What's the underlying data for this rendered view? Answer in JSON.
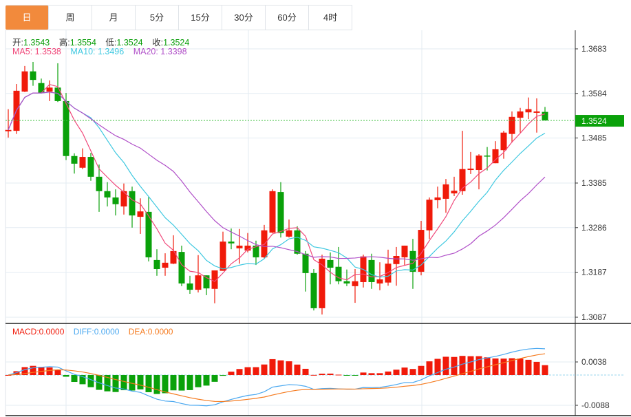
{
  "tabs": [
    "日",
    "周",
    "月",
    "5分",
    "15分",
    "30分",
    "60分",
    "4时"
  ],
  "active_tab": 0,
  "ohlc": {
    "open_label": "开:",
    "open": "1.3543",
    "high_label": "高:",
    "high": "1.3554",
    "low_label": "低:",
    "low": "1.3524",
    "close_label": "收:",
    "close": "1.3524"
  },
  "ma": {
    "ma5": "MA5: 1.3538",
    "ma10": "MA10: 1.3496",
    "ma20": "MA20: 1.3398"
  },
  "macd_legend": {
    "macd": "MACD:0.0000",
    "diff": "DIFF:0.0000",
    "dea": "DEA:0.0000"
  },
  "colors": {
    "up": "#f01a0a",
    "down": "#0aa10a",
    "ma5": "#f0487a",
    "ma10": "#3ec8e0",
    "ma20": "#b04fc8",
    "tab_active": "#f28a3c",
    "diff": "#4aa8f0",
    "dea": "#f57a1e"
  },
  "chart_data": {
    "type": "candlestick",
    "price_axis": {
      "ticks": [
        "1.3683",
        "1.3584",
        "1.3485",
        "1.3385",
        "1.3286",
        "1.3187",
        "1.3087"
      ],
      "range": [
        1.3087,
        1.3683
      ]
    },
    "last_price": "1.3524",
    "macd_axis": {
      "ticks": [
        "0.0038",
        "-0.0088"
      ]
    },
    "candles": [
      [
        1.35,
        1.3549,
        1.3486,
        1.3503
      ],
      [
        1.3501,
        1.3605,
        1.3494,
        1.359
      ],
      [
        1.3588,
        1.3645,
        1.3587,
        1.3633
      ],
      [
        1.3633,
        1.3654,
        1.3601,
        1.3614
      ],
      [
        1.3607,
        1.3617,
        1.3584,
        1.3585
      ],
      [
        1.3588,
        1.3613,
        1.3567,
        1.3597
      ],
      [
        1.3597,
        1.3651,
        1.3565,
        1.3567
      ],
      [
        1.3567,
        1.3585,
        1.3436,
        1.3445
      ],
      [
        1.3445,
        1.3451,
        1.3406,
        1.3428
      ],
      [
        1.3419,
        1.3462,
        1.3416,
        1.3443
      ],
      [
        1.3443,
        1.3452,
        1.339,
        1.3399
      ],
      [
        1.3399,
        1.3426,
        1.3321,
        1.3367
      ],
      [
        1.3367,
        1.3387,
        1.3333,
        1.3353
      ],
      [
        1.3353,
        1.3371,
        1.3313,
        1.3338
      ],
      [
        1.3333,
        1.3384,
        1.3315,
        1.3367
      ],
      [
        1.3367,
        1.3377,
        1.3286,
        1.3313
      ],
      [
        1.331,
        1.3351,
        1.3272,
        1.3322
      ],
      [
        1.3321,
        1.3354,
        1.3211,
        1.322
      ],
      [
        1.3214,
        1.3238,
        1.3179,
        1.3194
      ],
      [
        1.3197,
        1.3229,
        1.3179,
        1.3208
      ],
      [
        1.3206,
        1.3269,
        1.3205,
        1.3234
      ],
      [
        1.3232,
        1.3246,
        1.3156,
        1.3162
      ],
      [
        1.3162,
        1.3179,
        1.3139,
        1.3148
      ],
      [
        1.3148,
        1.3225,
        1.3142,
        1.318
      ],
      [
        1.318,
        1.318,
        1.3136,
        1.3151
      ],
      [
        1.315,
        1.3191,
        1.3118,
        1.3191
      ],
      [
        1.319,
        1.3277,
        1.319,
        1.3255
      ],
      [
        1.3255,
        1.3284,
        1.3238,
        1.3251
      ],
      [
        1.324,
        1.3283,
        1.3206,
        1.3246
      ],
      [
        1.3235,
        1.3274,
        1.3231,
        1.3246
      ],
      [
        1.3246,
        1.3257,
        1.3203,
        1.322
      ],
      [
        1.322,
        1.3292,
        1.3217,
        1.328
      ],
      [
        1.3275,
        1.3371,
        1.3274,
        1.3367
      ],
      [
        1.3365,
        1.3387,
        1.3264,
        1.3274
      ],
      [
        1.3266,
        1.3304,
        1.3264,
        1.328
      ],
      [
        1.328,
        1.3289,
        1.3226,
        1.3228
      ],
      [
        1.3228,
        1.3234,
        1.3144,
        1.3185
      ],
      [
        1.3185,
        1.3194,
        1.3102,
        1.3107
      ],
      [
        1.3107,
        1.3226,
        1.3093,
        1.3217
      ],
      [
        1.3214,
        1.3231,
        1.316,
        1.3197
      ],
      [
        1.3199,
        1.3243,
        1.316,
        1.3167
      ],
      [
        1.3167,
        1.3193,
        1.3156,
        1.3162
      ],
      [
        1.3156,
        1.3194,
        1.3119,
        1.3167
      ],
      [
        1.3165,
        1.3226,
        1.3153,
        1.3222
      ],
      [
        1.3214,
        1.3228,
        1.315,
        1.3165
      ],
      [
        1.3162,
        1.3209,
        1.3147,
        1.3171
      ],
      [
        1.3164,
        1.3237,
        1.3157,
        1.3206
      ],
      [
        1.3205,
        1.3243,
        1.3157,
        1.3223
      ],
      [
        1.322,
        1.3246,
        1.3203,
        1.3246
      ],
      [
        1.3234,
        1.3261,
        1.315,
        1.3188
      ],
      [
        1.3188,
        1.3301,
        1.318,
        1.3281
      ],
      [
        1.328,
        1.3353,
        1.3261,
        1.3348
      ],
      [
        1.3347,
        1.3377,
        1.3329,
        1.3353
      ],
      [
        1.335,
        1.3394,
        1.3319,
        1.3382
      ],
      [
        1.3362,
        1.3399,
        1.3356,
        1.3368
      ],
      [
        1.3367,
        1.3501,
        1.3359,
        1.3416
      ],
      [
        1.3414,
        1.3454,
        1.3405,
        1.3417
      ],
      [
        1.3414,
        1.3449,
        1.3371,
        1.3446
      ],
      [
        1.3446,
        1.3465,
        1.3413,
        1.3445
      ],
      [
        1.3429,
        1.3478,
        1.3429,
        1.346
      ],
      [
        1.3458,
        1.3501,
        1.3439,
        1.3497
      ],
      [
        1.3494,
        1.3544,
        1.3475,
        1.3532
      ],
      [
        1.353,
        1.3552,
        1.3497,
        1.3544
      ],
      [
        1.3542,
        1.3575,
        1.3527,
        1.3549
      ],
      [
        1.3541,
        1.3573,
        1.3497,
        1.3544
      ],
      [
        1.3543,
        1.3554,
        1.3524,
        1.3524
      ]
    ]
  }
}
